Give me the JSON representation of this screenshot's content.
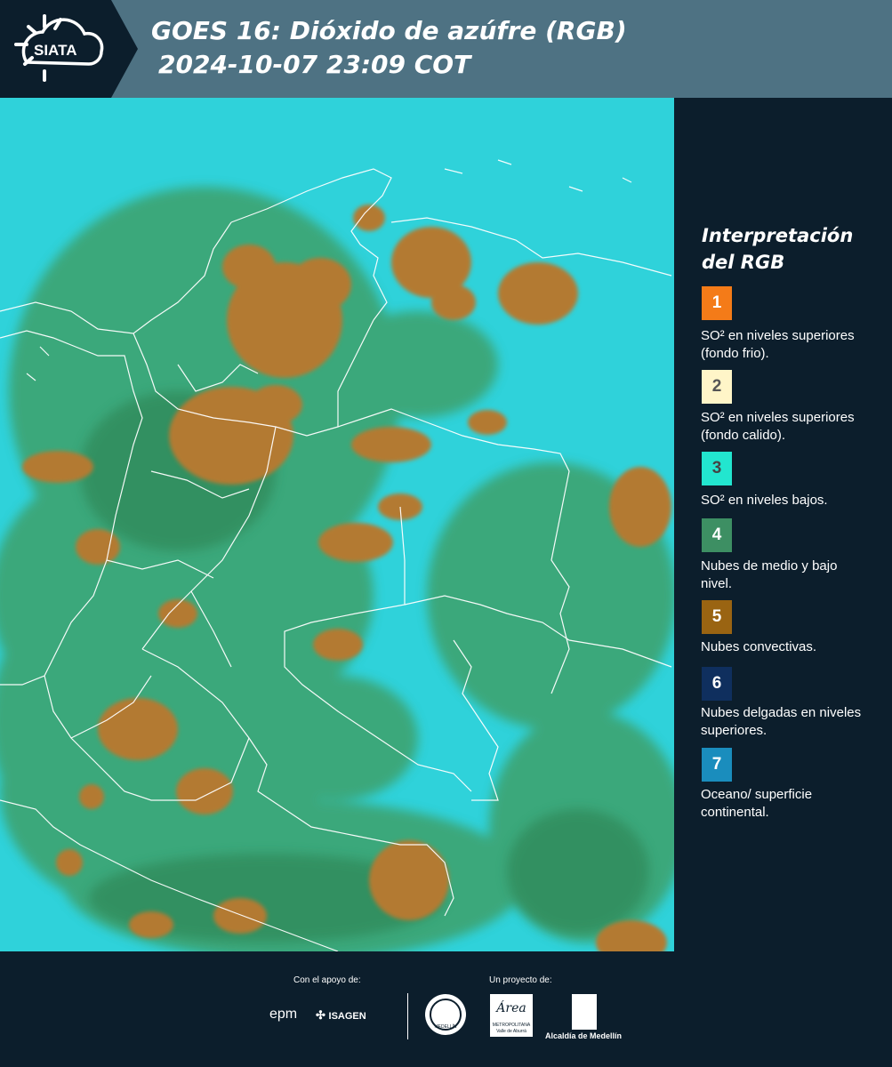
{
  "header": {
    "logo_text": "SIATA",
    "title_line1": "GOES 16: Dióxido de azúfre (RGB)",
    "title_line2": "2024-10-07 23:09 COT"
  },
  "legend": {
    "title": "Interpretación del RGB",
    "items": [
      {
        "number": "1",
        "color": "#f47b18",
        "text_color": "#ffffff",
        "label": "SO² en niveles superiores (fondo frio)."
      },
      {
        "number": "2",
        "color": "#fff5c8",
        "text_color": "#555555",
        "label": "SO² en niveles superiores (fondo calido)."
      },
      {
        "number": "3",
        "color": "#22e6cf",
        "text_color": "#444444",
        "label": "SO² en niveles bajos."
      },
      {
        "number": "4",
        "color": "#3d8f63",
        "text_color": "#ffffff",
        "label": "Nubes de medio y bajo nivel."
      },
      {
        "number": "5",
        "color": "#9a6412",
        "text_color": "#ffffff",
        "label": "Nubes convectivas."
      },
      {
        "number": "6",
        "color": "#0f2f5e",
        "text_color": "#ffffff",
        "label": "Nubes delgadas en niveles superiores."
      },
      {
        "number": "7",
        "color": "#1a8dbd",
        "text_color": "#ffffff",
        "label": "Oceano/ superficie continental."
      }
    ]
  },
  "footer": {
    "support_label": "Con el apoyo de:",
    "project_label": "Un proyecto de:",
    "epm": "epm",
    "isagen": "ISAGEN",
    "medellin_seal": "MEDELLÍN",
    "area_name": "Área",
    "area_sub": "METROPOLITANA",
    "area_sub2": "Valle de Aburrá",
    "alcaldia": "Alcaldía de Medellín"
  },
  "colors": {
    "header_bg": "#4e7283",
    "logo_bg": "#0c1e2c",
    "panel_bg": "#0c1e2c",
    "ocean_cyan": "#2fd4dc",
    "cloud_low": "#3d8f63",
    "cloud_convective": "#b07a30"
  }
}
